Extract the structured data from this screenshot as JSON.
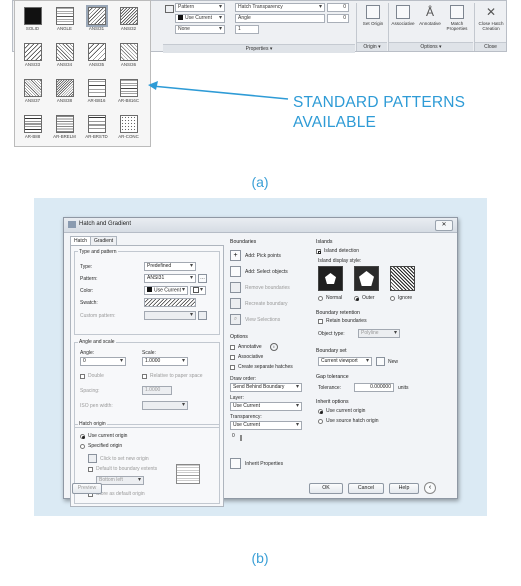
{
  "figure_a": {
    "ribbon": {
      "pattern_label": "Pattern",
      "transparency_label": "Hatch Transparency",
      "transparency_value": "0",
      "color_value": "Use Current",
      "angle_label": "Angle",
      "angle_value": "0",
      "bgcolor_value": "None",
      "scale_value": "1",
      "properties_label": "Properties ▾",
      "origin_label": "Origin ▾",
      "options_label": "Options ▾",
      "close_label": "Close",
      "buttons": {
        "set_origin": "Set Origin",
        "associative": "Associative",
        "annotative": "Annotative",
        "match_properties": "Match Properties",
        "close_hatch": "Close Hatch Creation"
      }
    },
    "gallery": {
      "patterns": [
        "SOLID",
        "ANGLE",
        "ANSI31",
        "ANSI32",
        "ANSI33",
        "ANSI34",
        "ANSI35",
        "ANSI36",
        "ANSI37",
        "ANSI38",
        "AR-B816",
        "AR-B816C",
        "AR-B88",
        "AR-BRELM",
        "AR-BRSTD",
        "AR-CONC"
      ],
      "selected": "ANSI31"
    },
    "callout_line1": "STANDARD PATTERNS",
    "callout_line2": "AVAILABLE",
    "caption": "(a)"
  },
  "figure_b": {
    "title": "Hatch and Gradient",
    "tabs": [
      "Hatch",
      "Gradient"
    ],
    "type_and_pattern": {
      "heading": "Type and pattern",
      "type_label": "Type:",
      "type_value": "Predefined",
      "pattern_label": "Pattern:",
      "pattern_value": "ANSI31",
      "color_label": "Color:",
      "color_value": "Use Current",
      "swatch_label": "Swatch:",
      "custom_pattern_label": "Custom pattern:"
    },
    "angle_and_scale": {
      "heading": "Angle and scale",
      "angle_label": "Angle:",
      "angle_value": "0",
      "scale_label": "Scale:",
      "scale_value": "1.0000",
      "double_label": "Double",
      "relative_label": "Relative to paper space",
      "spacing_label": "Spacing:",
      "spacing_value": "1.0000",
      "iso_label": "ISO pen width:"
    },
    "hatch_origin": {
      "heading": "Hatch origin",
      "use_current": "Use current origin",
      "specified": "Specified origin",
      "click_to_set": "Click to set new origin",
      "default_extents": "Default to boundary extents",
      "position_value": "Bottom left",
      "store_default": "Store as default origin"
    },
    "boundaries": {
      "heading": "Boundaries",
      "add_pick": "Add: Pick points",
      "add_select": "Add: Select objects",
      "remove": "Remove boundaries",
      "recreate": "Recreate boundary",
      "view": "View Selections"
    },
    "options": {
      "heading": "Options",
      "annotative": "Annotative",
      "associative": "Associative",
      "separate": "Create separate hatches",
      "draw_order_label": "Draw order:",
      "draw_order_value": "Send Behind Boundary",
      "layer_label": "Layer:",
      "layer_value": "Use Current",
      "transparency_label": "Transparency:",
      "transparency_value": "Use Current",
      "transparency_number": "0",
      "inherit": "Inherit Properties"
    },
    "islands": {
      "heading": "Islands",
      "detection": "Island detection",
      "style_label": "Island display style:",
      "normal": "Normal",
      "outer": "Outer",
      "ignore": "Ignore"
    },
    "boundary_retention": {
      "heading": "Boundary retention",
      "retain": "Retain boundaries",
      "object_type_label": "Object type:",
      "object_type_value": "Polyline"
    },
    "boundary_set": {
      "heading": "Boundary set",
      "value": "Current viewport",
      "new_label": "New"
    },
    "gap_tolerance": {
      "heading": "Gap tolerance",
      "label": "Tolerance:",
      "value": "0.000000",
      "units": "units"
    },
    "inherit_options": {
      "heading": "Inherit options",
      "use_current": "Use current origin",
      "use_source": "Use source hatch origin"
    },
    "footer": {
      "preview": "Preview",
      "ok": "OK",
      "cancel": "Cancel",
      "help": "Help"
    },
    "caption": "(b)"
  },
  "colors": {
    "callout": "#2e9bd6",
    "panel_bg": "#dbeaf4"
  }
}
